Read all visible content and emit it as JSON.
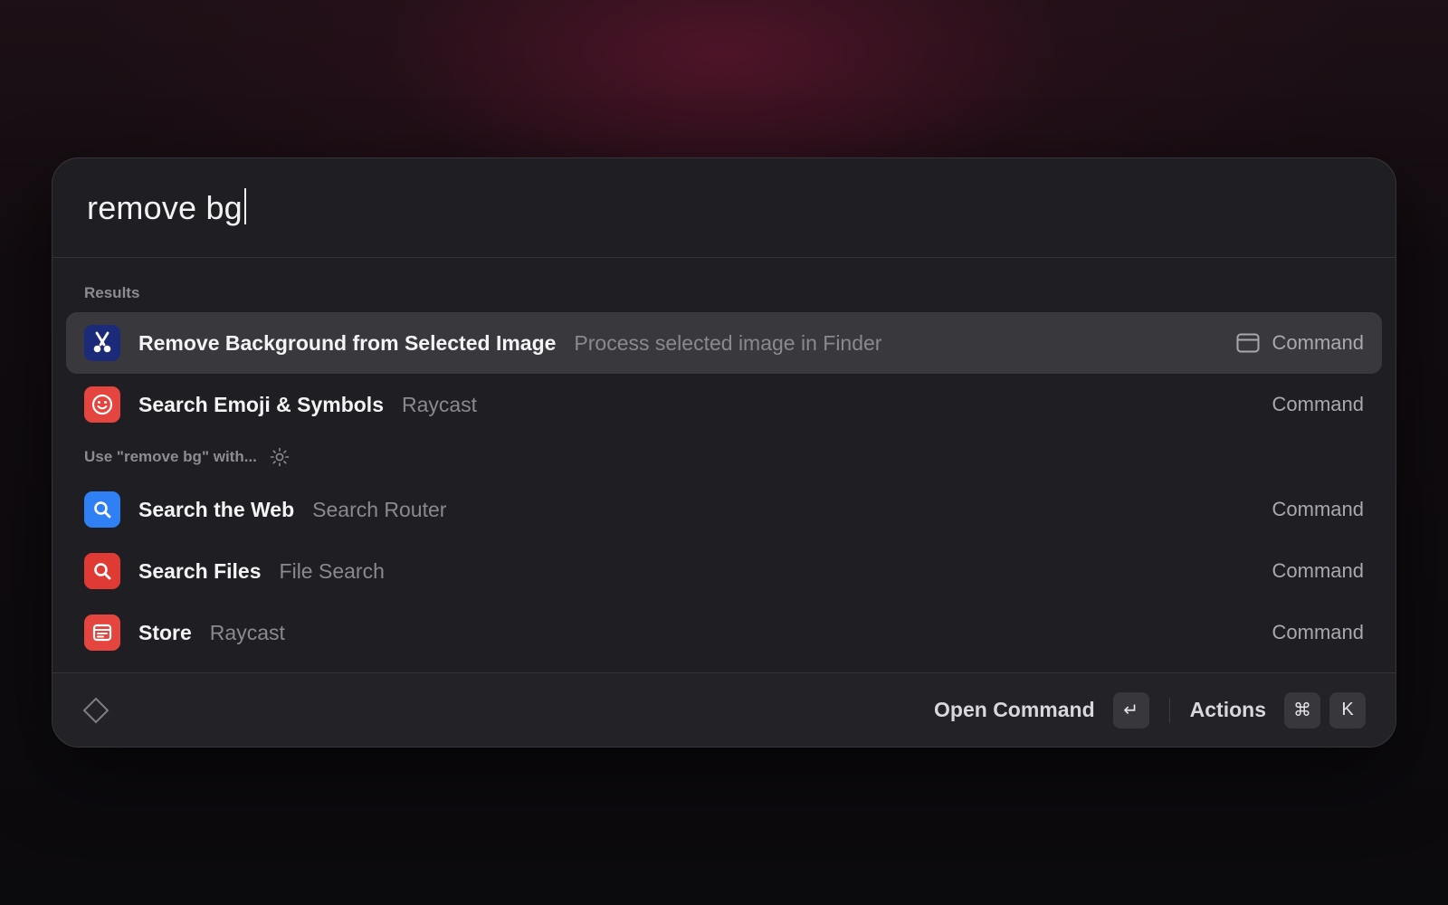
{
  "search": {
    "query": "remove bg"
  },
  "sections": {
    "results_header": "Results",
    "fallback_header": "Use \"remove bg\" with..."
  },
  "results": [
    {
      "title": "Remove Background from Selected Image",
      "subtitle": "Process selected image in Finder",
      "accessory": "Command",
      "icon": "scissors-icon",
      "icon_bg": "#1c2a7a",
      "selected": true
    },
    {
      "title": "Search Emoji & Symbols",
      "subtitle": "Raycast",
      "accessory": "Command",
      "icon": "smiley-icon",
      "icon_bg": "#e5453f",
      "selected": false
    }
  ],
  "fallbacks": [
    {
      "title": "Search the Web",
      "subtitle": "Search Router",
      "accessory": "Command",
      "icon": "search-icon",
      "icon_bg": "#2f7ff5"
    },
    {
      "title": "Search Files",
      "subtitle": "File Search",
      "accessory": "Command",
      "icon": "search-icon",
      "icon_bg": "#e03a35"
    },
    {
      "title": "Store",
      "subtitle": "Raycast",
      "accessory": "Command",
      "icon": "store-icon",
      "icon_bg": "#e5453f"
    }
  ],
  "footer": {
    "primary_action": "Open Command",
    "primary_key": "↵",
    "secondary_action": "Actions",
    "secondary_keys": [
      "⌘",
      "K"
    ]
  },
  "colors": {
    "window_bg": "#1f1e22",
    "selected_row": "#39383d",
    "accent_glow": "#78183a"
  }
}
